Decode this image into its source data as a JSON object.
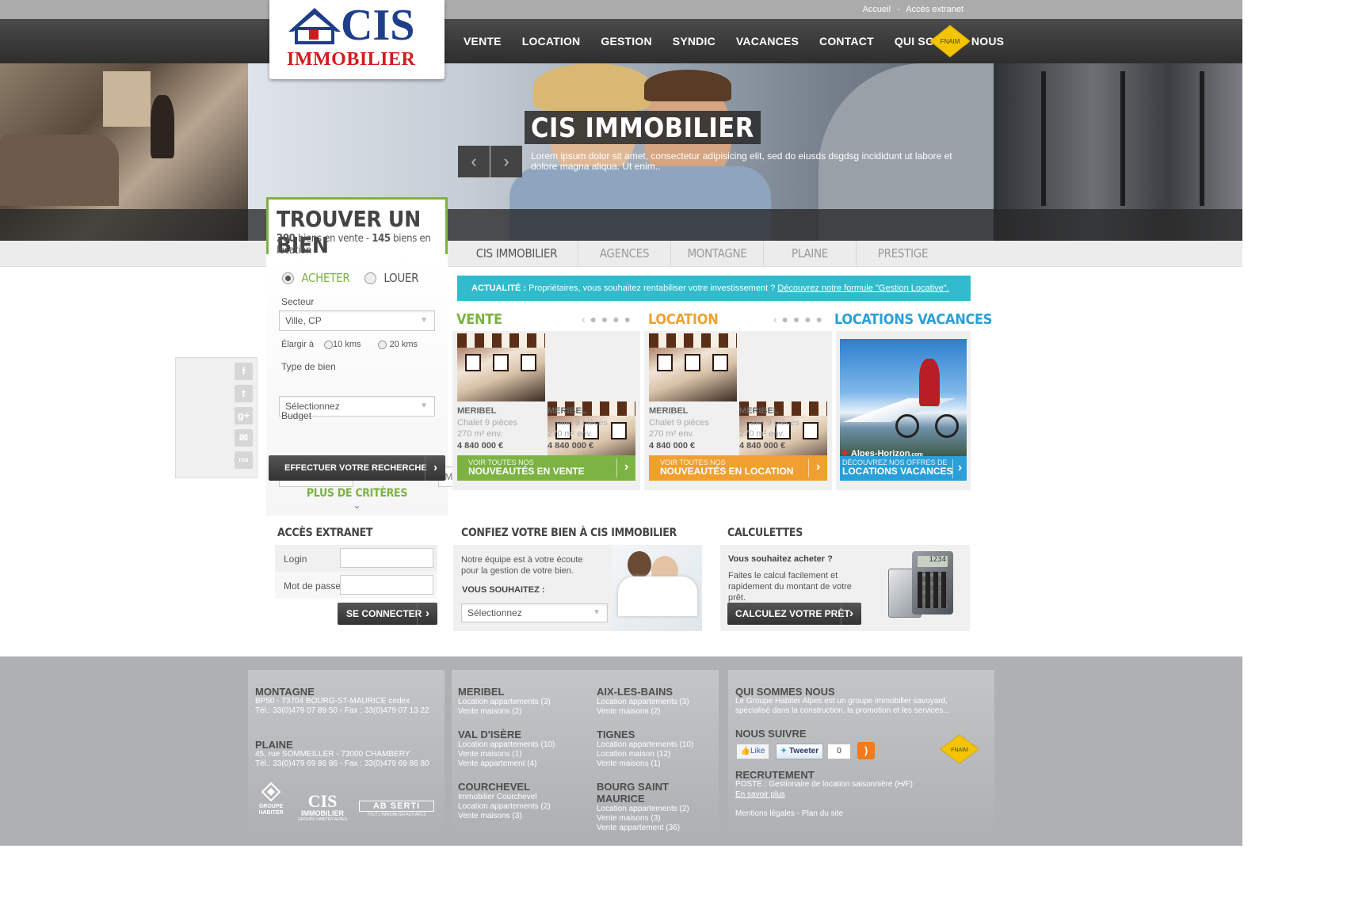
{
  "top": {
    "links": [
      "Accueil",
      "Accès extranet"
    ],
    "separator": "-"
  },
  "logo": {
    "line1": "CIS",
    "line2": "IMMOBILIER"
  },
  "nav": [
    "VENTE",
    "LOCATION",
    "GESTION",
    "SYNDIC",
    "VACANCES",
    "CONTACT",
    "QUI SOMMES NOUS"
  ],
  "fnaim": "FNAIM",
  "hero": {
    "title": "CIS IMMOBILIER",
    "caption": "Lorem ipsum dolor sit amet, consectetur adipisicing elit, sed do eiusds dsgdsg incididunt ut labore et dolore magna aliqua. Ut enim..",
    "prev": "‹",
    "next": "›"
  },
  "tabs": [
    "CIS IMMOBILIER",
    "AGENCES",
    "MONTAGNE",
    "PLAINE",
    "PRESTIGE"
  ],
  "search": {
    "title": "TROUVER UN BIEN",
    "count_sale": "200",
    "sale_text": "biens en vente -",
    "count_rent": "145",
    "rent_text": "biens en location",
    "buy": "ACHETER",
    "rent": "LOUER",
    "sector_label": "Secteur",
    "sector_value": "Ville, CP",
    "widen_label": "Élargir à",
    "widen_10": "10 kms",
    "widen_20": "20 kms",
    "type_label": "Type de bien",
    "type_value": "Sélectionnez",
    "budget_label": "Budget",
    "min_placeholder": "Min",
    "max_placeholder": "Max",
    "submit": "EFFECTUER VOTRE RECHERCHE",
    "more": "PLUS DE CRITÈRES"
  },
  "social": [
    "f",
    "t",
    "g+",
    "✉",
    "rss"
  ],
  "actu": {
    "label": "ACTUALITÉ :",
    "text": "Propriétaires, vous souhaitez rentabiliser votre investissement ?",
    "link": "Découvrez notre formule \"Gestion Locative\"."
  },
  "vente": {
    "title": "VENTE",
    "color": "#7cb342",
    "cards": [
      {
        "city": "MERIBEL",
        "type": "Chalet 9 pièces",
        "area": "270 m² env.",
        "price": "4 840 000 €"
      },
      {
        "city": "MERIBEL",
        "type": "Chalet 9 pièces",
        "area": "270 m² env.",
        "price": "4 840 000 €"
      }
    ],
    "cta_small": "VOIR TOUTES NOS",
    "cta_big": "NOUVEAUTÉS EN VENTE"
  },
  "location": {
    "title": "LOCATION",
    "color": "#f0a030",
    "cards": [
      {
        "city": "MERIBEL",
        "type": "Chalet 9 pièces",
        "area": "270 m² env.",
        "price": "4 840 000 €"
      },
      {
        "city": "MERIBEL",
        "type": "Chalet 9 pièces",
        "area": "270 m² env.",
        "price": "4 840 000 €"
      }
    ],
    "cta_small": "VOIR TOUTES NOS",
    "cta_big": "NOUVEAUTÉS EN LOCATION"
  },
  "vacances": {
    "title": "LOCATIONS VACANCES",
    "color": "#2a9fd8",
    "brand": "Alpes-Horizon",
    "brand_suffix": ".com",
    "cta_small": "DÉCOUVREZ NOS OFFRES DE",
    "cta_big": "LOCATIONS VACANCES"
  },
  "extranet": {
    "title": "ACCÈS EXTRANET",
    "login": "Login",
    "password": "Mot de passe",
    "submit": "SE CONNECTER"
  },
  "confiez": {
    "title": "CONFIEZ VOTRE BIEN À CIS IMMOBILIER",
    "text": "Notre équipe est à votre écoute pour la gestion de votre bien.",
    "question": "VOUS SOUHAITEZ :",
    "select": "Sélectionnez"
  },
  "calc": {
    "title": "CALCULETTES",
    "q": "Vous souhaitez acheter ?",
    "text": "Faites le calcul facilement et rapidement du montant de votre prêt.",
    "button": "CALCULEZ VOTRE PRÊT",
    "display": "1234"
  },
  "footer": {
    "montagne": {
      "title": "MONTAGNE",
      "lines": [
        "BP50 - 73704 BOURG-ST-MAURICE cedex",
        "Tél.: 33(0)479 07 89 50 - Fax : 33(0)479 07 13 22"
      ]
    },
    "plaine": {
      "title": "PLAINE",
      "lines": [
        "45, rue SOMMEILLER - 73000 CHAMBERY",
        "Tél.: 33(0)479 69 86 86 - Fax : 33(0)479 69 86 80"
      ]
    },
    "logos": {
      "groupe": "GROUPE HABITER",
      "cis": "CIS",
      "cis_sub": "IMMOBILIER",
      "cis_tag": "GROUPE HABITER ALPES",
      "abs": "AB SERTI",
      "abs_tag": "TOUT L'IMMOBILIER AUX ARCS"
    },
    "cities_left": [
      {
        "title": "MERIBEL",
        "lines": [
          "Location appartements (3)",
          "Vente maisons (2)"
        ]
      },
      {
        "title": "VAL D'ISÈRE",
        "lines": [
          "Location appartements (10)",
          "Vente maisons (1)",
          "Vente appartement (4)"
        ]
      },
      {
        "title": "COURCHEVEL",
        "lines": [
          "Immobilier Courchevel",
          "Location appartements (2)",
          "Vente maisons (3)"
        ]
      }
    ],
    "cities_right": [
      {
        "title": "AIX-LES-BAINS",
        "lines": [
          "Location appartements (3)",
          "Vente maisons (2)"
        ]
      },
      {
        "title": "TIGNES",
        "lines": [
          "Location appartements (10)",
          "Location maison (12)",
          "Vente maisons (1)"
        ]
      },
      {
        "title": "BOURG SAINT MAURICE",
        "lines": [
          "Location appartements (2)",
          "Vente maisons (3)",
          "Vente appartement (36)"
        ]
      }
    ],
    "about": {
      "title": "QUI SOMMES NOUS",
      "text": "Le Groupe Habiter Alpes est un groupe immobilier savoyard, spécialisé dans la construction, la promotion et les services..."
    },
    "follow": {
      "title": "NOUS SUIVRE",
      "like": "Like",
      "tweet": "Tweeter",
      "count": "0"
    },
    "jobs": {
      "title": "RECRUTEMENT",
      "text": "POSTE : Gestionaire de location saisonnière (H/F)",
      "more": "En savoir plus"
    },
    "legal": "Mentions légales - Plan du site"
  }
}
